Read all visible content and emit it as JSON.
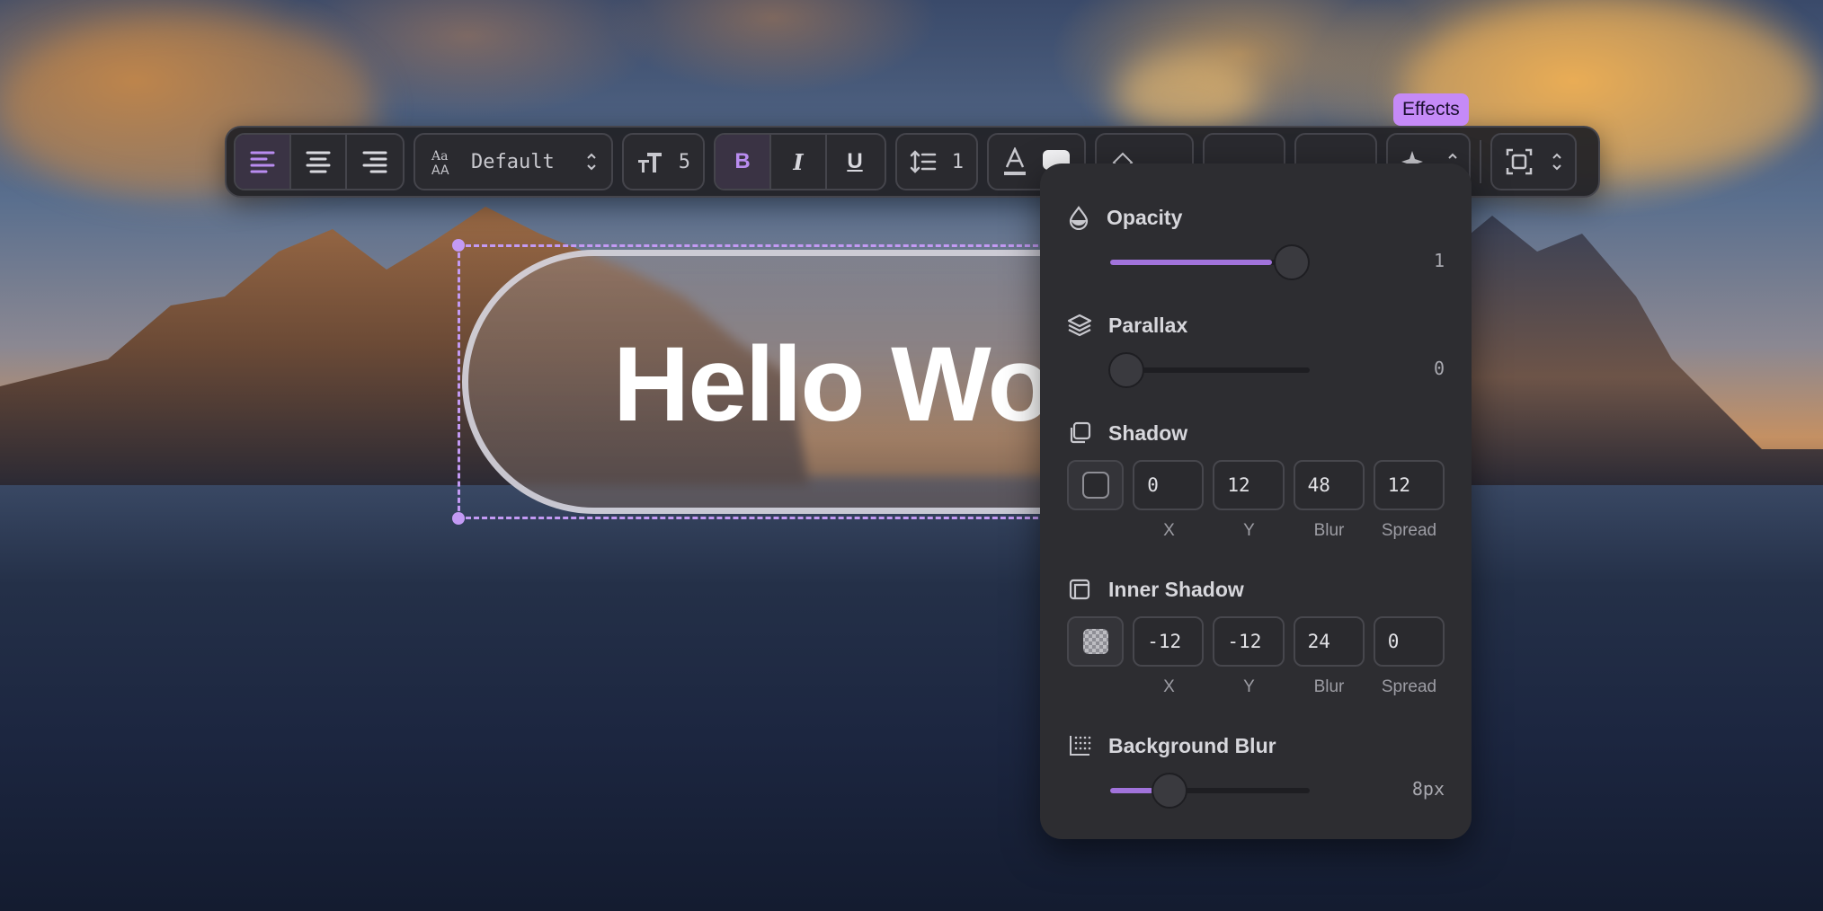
{
  "canvas": {
    "text": "Hello Wo"
  },
  "toolbar": {
    "font_family": "Default",
    "font_size": "5",
    "line_height": "1",
    "bold_label": "B",
    "italic_label": "I",
    "underline_label": "U",
    "alignment_active": "left"
  },
  "tooltip": {
    "label": "Effects"
  },
  "effects": {
    "opacity": {
      "title": "Opacity",
      "value": "1",
      "level": 1
    },
    "parallax": {
      "title": "Parallax",
      "value": "0",
      "level": 0
    },
    "shadow": {
      "title": "Shadow",
      "x": "0",
      "y": "12",
      "blur": "48",
      "spread": "12",
      "labels": [
        "X",
        "Y",
        "Blur",
        "Spread"
      ]
    },
    "inner_shadow": {
      "title": "Inner Shadow",
      "x": "-12",
      "y": "-12",
      "blur": "24",
      "spread": "0",
      "labels": [
        "X",
        "Y",
        "Blur",
        "Spread"
      ]
    },
    "background_blur": {
      "title": "Background Blur",
      "value": "8px",
      "level": 0.2
    }
  },
  "colors": {
    "accent": "#b98cf0",
    "tooltip": "#c58af7",
    "panel": "#2d2d31"
  }
}
